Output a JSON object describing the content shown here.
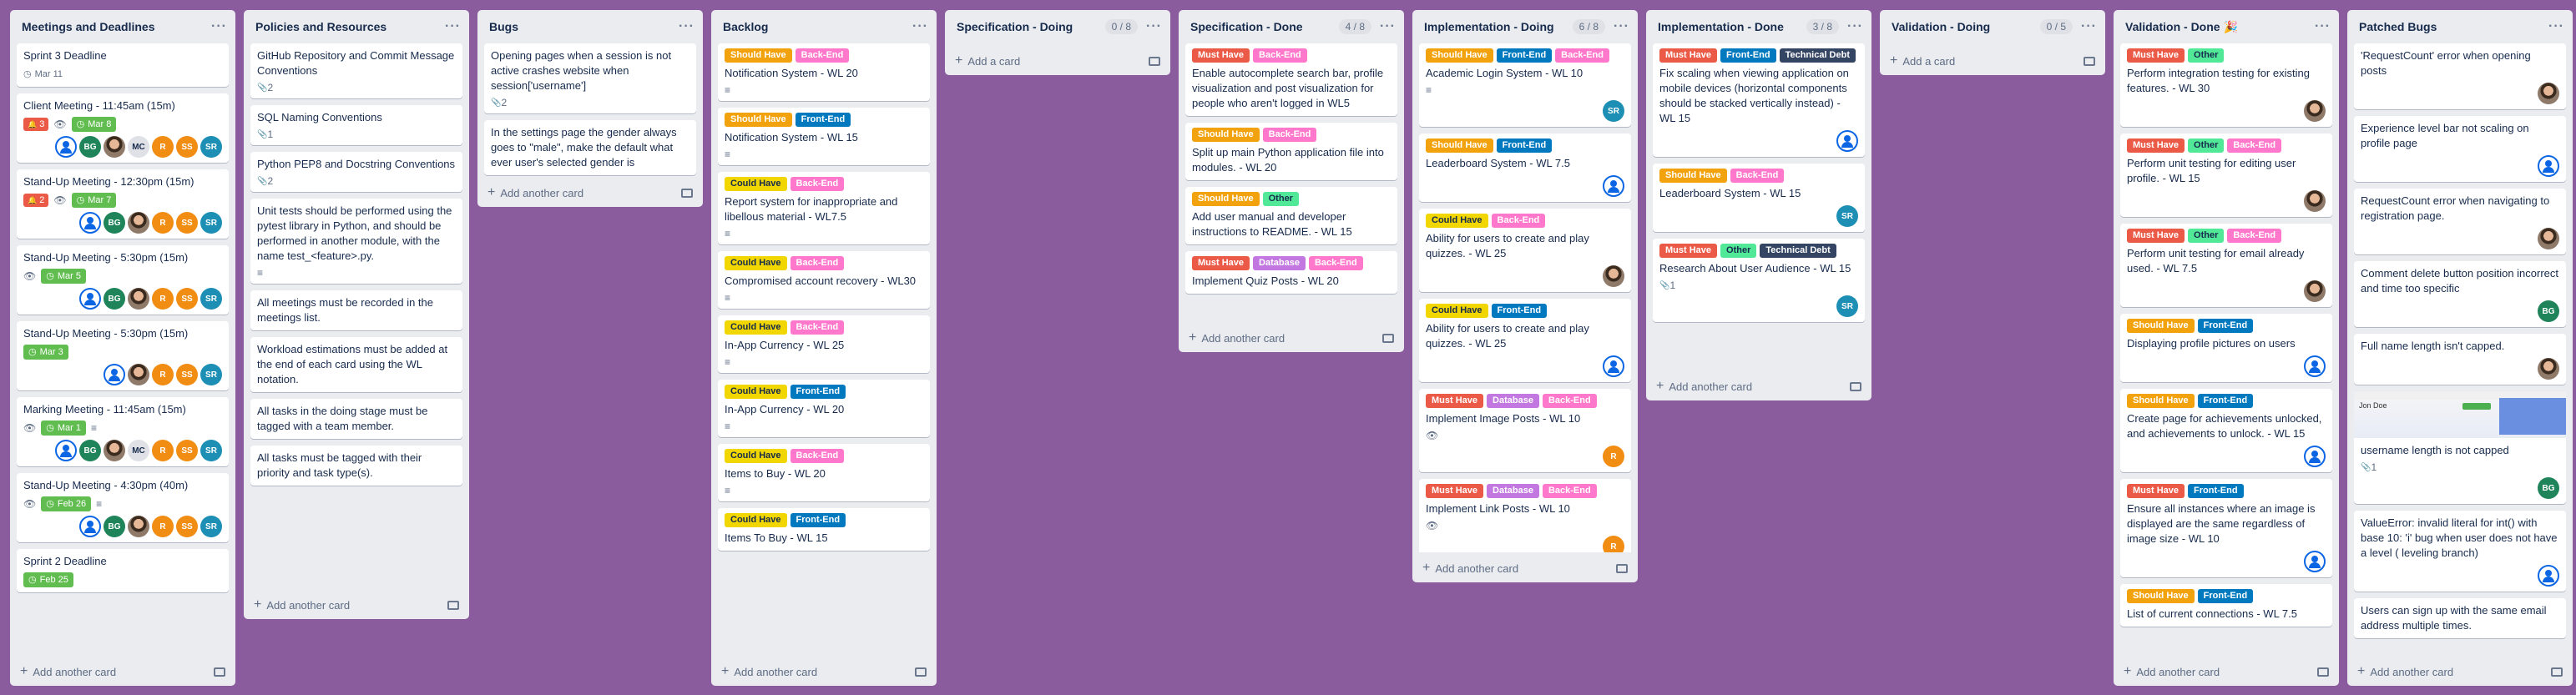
{
  "board": {
    "lists": [
      {
        "title": "Meetings and Deadlines",
        "add": "Add another card",
        "cards": [
          {
            "text": "Sprint 3 Deadline",
            "badges": {
              "due": "Mar 11",
              "due_style": "plain"
            }
          },
          {
            "text": "Client Meeting - 11:45am (15m)",
            "badges": {
              "notif": "3",
              "watch": true,
              "due": "Mar 8",
              "due_style": "ok"
            },
            "members": [
              "blue",
              "BG",
              "ph",
              "MC",
              "R",
              "SS",
              "SR"
            ]
          },
          {
            "text": "Stand-Up Meeting - 12:30pm (15m)",
            "badges": {
              "notif": "2",
              "watch": true,
              "due": "Mar 7",
              "due_style": "ok"
            },
            "members": [
              "blue",
              "BG",
              "ph",
              "R",
              "SS",
              "SR"
            ]
          },
          {
            "text": "Stand-Up Meeting - 5:30pm (15m)",
            "badges": {
              "watch": true,
              "due": "Mar 5",
              "due_style": "ok"
            },
            "members": [
              "blue",
              "BG",
              "ph",
              "R",
              "SS",
              "SR"
            ]
          },
          {
            "text": "Stand-Up Meeting - 5:30pm (15m)",
            "badges": {
              "due": "Mar 3",
              "due_style": "ok"
            },
            "members": [
              "blue",
              "ph",
              "R",
              "SS",
              "SR"
            ]
          },
          {
            "text": "Marking Meeting - 11:45am (15m)",
            "badges": {
              "watch": true,
              "due": "Mar 1",
              "due_style": "ok",
              "desc": true
            },
            "members": [
              "blue",
              "BG",
              "ph",
              "MC",
              "R",
              "SS",
              "SR"
            ]
          },
          {
            "text": "Stand-Up Meeting - 4:30pm (40m)",
            "badges": {
              "watch": true,
              "due": "Feb 26",
              "due_style": "ok",
              "desc": true
            },
            "members": [
              "blue",
              "BG",
              "ph",
              "R",
              "SS",
              "SR"
            ]
          },
          {
            "text": "Sprint 2 Deadline",
            "badges": {
              "due": "Feb 25",
              "due_style": "ok"
            }
          }
        ]
      },
      {
        "title": "Policies and Resources",
        "add": "Add another card",
        "cards": [
          {
            "text": "GitHub Repository and Commit Message Conventions",
            "badges": {
              "attach": "2"
            }
          },
          {
            "text": "SQL Naming Conventions",
            "badges": {
              "attach": "1"
            }
          },
          {
            "text": "Python PEP8 and Docstring Conventions",
            "badges": {
              "attach": "2"
            }
          },
          {
            "text": "Unit tests should be performed using the pytest library in Python, and should be performed in another module, with the name test_<feature>.py.",
            "badges": {
              "desc": true
            }
          },
          {
            "text": "All meetings must be recorded in the meetings list."
          },
          {
            "text": "Workload estimations must be added at the end of each card using the WL notation."
          },
          {
            "text": "All tasks in the doing stage must be tagged with a team member."
          },
          {
            "text": "All tasks must be tagged with their priority and task type(s)."
          }
        ]
      },
      {
        "title": "Bugs",
        "add": "Add another card",
        "cards": [
          {
            "text": "Opening pages when a session is not active crashes website when session['username']",
            "badges": {
              "attach": "2"
            }
          },
          {
            "text": "In the settings page the gender always goes to \"male\", make the default what ever user's selected gender is"
          }
        ]
      },
      {
        "title": "Backlog",
        "add": "Add another card",
        "cards": [
          {
            "labels": [
              "Should Have",
              "Back-End"
            ],
            "text": "Notification System - WL 20",
            "badges": {
              "desc": true
            }
          },
          {
            "labels": [
              "Should Have",
              "Front-End"
            ],
            "text": "Notification System - WL 15",
            "badges": {
              "desc": true
            }
          },
          {
            "labels": [
              "Could Have",
              "Back-End"
            ],
            "text": "Report system for inappropriate and libellous material - WL7.5",
            "badges": {
              "desc": true
            }
          },
          {
            "labels": [
              "Could Have",
              "Back-End"
            ],
            "text": "Compromised account recovery - WL30",
            "badges": {
              "desc": true
            }
          },
          {
            "labels": [
              "Could Have",
              "Back-End"
            ],
            "text": "In-App Currency - WL 25",
            "badges": {
              "desc": true
            }
          },
          {
            "labels": [
              "Could Have",
              "Front-End"
            ],
            "text": "In-App Currency - WL 20",
            "badges": {
              "desc": true
            }
          },
          {
            "labels": [
              "Could Have",
              "Back-End"
            ],
            "text": "Items to Buy - WL 20",
            "badges": {
              "desc": true
            }
          },
          {
            "labels": [
              "Could Have",
              "Front-End"
            ],
            "text": "Items To Buy - WL 15"
          }
        ]
      },
      {
        "title": "Specification - Doing",
        "count": "0 / 8",
        "add": "Add a card",
        "cards": []
      },
      {
        "title": "Specification - Done",
        "count": "4 / 8",
        "add": "Add another card",
        "cards": [
          {
            "labels": [
              "Must Have",
              "Back-End"
            ],
            "text": "Enable autocomplete search bar, profile visualization and post visualization for people who aren't logged in WL5"
          },
          {
            "labels": [
              "Should Have",
              "Back-End"
            ],
            "text": "Split up main Python application file into modules. - WL 20"
          },
          {
            "labels": [
              "Should Have",
              "Other"
            ],
            "text": "Add user manual and developer instructions to README. - WL 15"
          },
          {
            "labels": [
              "Must Have",
              "Database",
              "Back-End"
            ],
            "text": "Implement Quiz Posts - WL 20"
          }
        ]
      },
      {
        "title": "Implementation - Doing",
        "count": "6 / 8",
        "add": "Add another card",
        "cards": [
          {
            "labels": [
              "Should Have",
              "Front-End",
              "Back-End"
            ],
            "text": "Academic Login System - WL 10",
            "badges": {
              "desc": true
            },
            "members": [
              "SR"
            ]
          },
          {
            "labels": [
              "Should Have",
              "Front-End"
            ],
            "text": "Leaderboard System - WL 7.5",
            "members": [
              "blue"
            ]
          },
          {
            "labels": [
              "Could Have",
              "Back-End"
            ],
            "text": "Ability for users to create and play quizzes. - WL 25",
            "members": [
              "ph"
            ]
          },
          {
            "labels": [
              "Could Have",
              "Front-End"
            ],
            "text": "Ability for users to create and play quizzes. - WL 25",
            "members": [
              "blue"
            ]
          },
          {
            "labels": [
              "Must Have",
              "Database",
              "Back-End"
            ],
            "text": "Implement Image Posts - WL 10",
            "badges": {
              "watch": true
            },
            "members": [
              "R"
            ]
          },
          {
            "labels": [
              "Must Have",
              "Database",
              "Back-End"
            ],
            "text": "Implement Link Posts - WL 10",
            "badges": {
              "watch": true
            },
            "members": [
              "R"
            ]
          }
        ]
      },
      {
        "title": "Implementation - Done",
        "count": "3 / 8",
        "add": "Add another card",
        "cards": [
          {
            "labels": [
              "Must Have",
              "Front-End",
              "Technical Debt"
            ],
            "text": "Fix scaling when viewing application on mobile devices (horizontal components should be stacked vertically instead) - WL 15",
            "members": [
              "blue"
            ]
          },
          {
            "labels": [
              "Should Have",
              "Back-End"
            ],
            "text": "Leaderboard System - WL 15",
            "members": [
              "SR"
            ]
          },
          {
            "labels": [
              "Must Have",
              "Other",
              "Technical Debt"
            ],
            "text": "Research About User Audience - WL 15",
            "badges": {
              "attach": "1"
            },
            "members": [
              "SR"
            ]
          }
        ]
      },
      {
        "title": "Validation - Doing",
        "count": "0 / 5",
        "add": "Add a card",
        "cards": []
      },
      {
        "title": "Validation - Done 🎉",
        "add": "Add another card",
        "cards": [
          {
            "labels": [
              "Must Have",
              "Other"
            ],
            "text": "Perform integration testing for existing features. - WL 30",
            "members": [
              "ph"
            ]
          },
          {
            "labels": [
              "Must Have",
              "Other",
              "Back-End"
            ],
            "text": "Perform unit testing for editing user profile. - WL 15",
            "members": [
              "ph"
            ]
          },
          {
            "labels": [
              "Must Have",
              "Other",
              "Back-End"
            ],
            "text": "Perform unit testing for email already used. - WL 7.5",
            "members": [
              "ph"
            ]
          },
          {
            "labels": [
              "Should Have",
              "Front-End"
            ],
            "text": "Displaying profile pictures on users",
            "members": [
              "blue"
            ]
          },
          {
            "labels": [
              "Should Have",
              "Front-End"
            ],
            "text": "Create page for achievements unlocked, and achievements to unlock. - WL 15",
            "members": [
              "blue"
            ]
          },
          {
            "labels": [
              "Must Have",
              "Front-End"
            ],
            "text": "Ensure all instances where an image is displayed are the same regardless of image size - WL 10",
            "members": [
              "blue"
            ]
          },
          {
            "labels": [
              "Should Have",
              "Front-End"
            ],
            "text": "List of current connections - WL 7.5"
          }
        ]
      },
      {
        "title": "Patched Bugs",
        "add": "Add another card",
        "cards": [
          {
            "text": "'RequestCount' error when opening posts",
            "members": [
              "ph"
            ]
          },
          {
            "text": "Experience level bar not scaling on profile page",
            "members": [
              "blue"
            ]
          },
          {
            "text": "RequestCount error when navigating to registration page.",
            "members": [
              "ph"
            ]
          },
          {
            "text": "Comment delete button position incorrect and time too specific",
            "members": [
              "BG"
            ]
          },
          {
            "text": "Full name length isn't capped.",
            "members": [
              "ph"
            ]
          },
          {
            "cover": {
              "text": "Jon Doe"
            },
            "text": "username length is not capped",
            "badges": {
              "attach": "1"
            },
            "members": [
              "BG"
            ]
          },
          {
            "text": "ValueError: invalid literal for int() with base 10: 'i' bug when user does not have a level ( leveling branch)",
            "members": [
              "blue"
            ]
          },
          {
            "text": "Users can sign up with the same email address multiple times."
          }
        ]
      }
    ]
  },
  "label_colors": {
    "Must Have": "#eb5a46",
    "Should Have": "#f2a20d",
    "Could Have": "#f2d600",
    "Back-End": "#ff78cb",
    "Front-End": "#0079bf",
    "Database": "#c377e0",
    "Other": "#51e898",
    "Technical Debt": "#344563"
  },
  "icons": {
    "more": "ellipsis-icon",
    "add": "plus-icon",
    "template": "card-template-icon",
    "watch": "eye-icon",
    "desc": "description-icon",
    "attach": "paperclip-icon",
    "clock": "clock-icon",
    "notif": "notification-icon"
  }
}
